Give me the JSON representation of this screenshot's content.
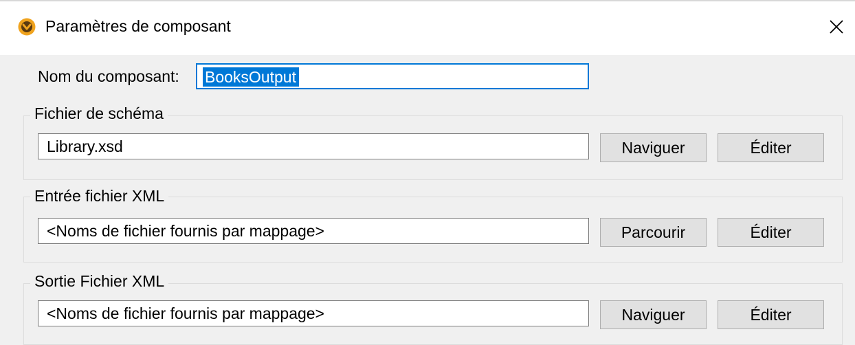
{
  "window": {
    "title": "Paramètres de composant",
    "icon": "altova-mapforce-icon",
    "close_icon": "close-icon"
  },
  "component_name": {
    "label": "Nom du composant:",
    "value": "BooksOutput"
  },
  "schema_file": {
    "group_title": "Fichier de schéma",
    "value": "Library.xsd",
    "browse_label": "Naviguer",
    "edit_label": "Éditer"
  },
  "xml_input": {
    "group_title": "Entrée fichier XML",
    "value": "<Noms de fichier fournis par mappage>",
    "browse_label": "Parcourir",
    "edit_label": "Éditer"
  },
  "xml_output": {
    "group_title": "Sortie Fichier XML",
    "value": "<Noms de fichier fournis par mappage>",
    "browse_label": "Naviguer",
    "edit_label": "Éditer"
  },
  "colors": {
    "accent": "#0078d7",
    "icon_orange": "#f0a31e"
  }
}
